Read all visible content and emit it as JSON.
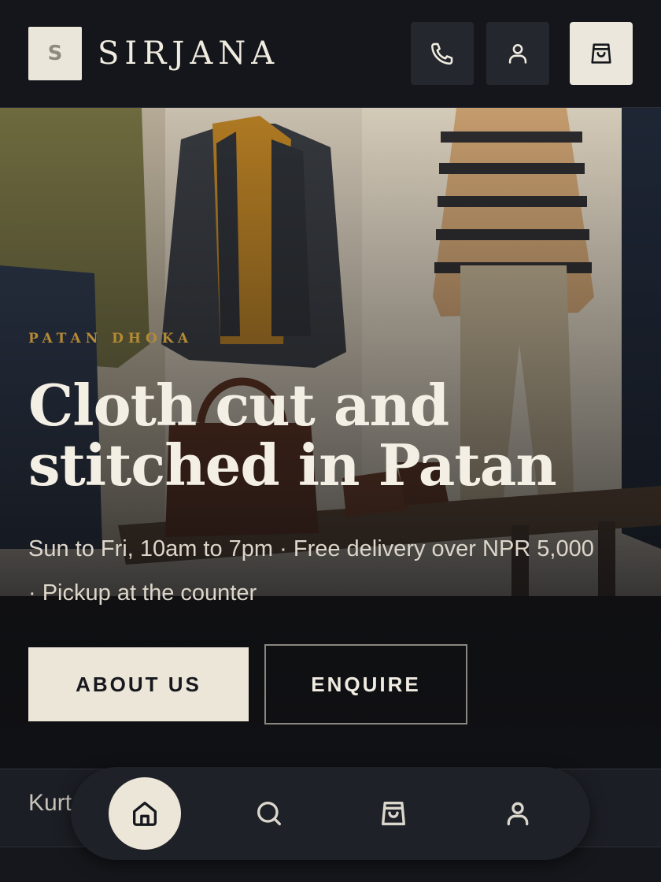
{
  "header": {
    "logo_letter": "S",
    "brand": "SIRJANA",
    "icons": [
      "phone-icon",
      "user-icon",
      "shopping-bag-icon"
    ]
  },
  "hero": {
    "eyebrow": "PATAN DHOKA",
    "headline": "Cloth cut and stitched in Patan",
    "subline": "Sun to Fri, 10am to 7pm · Free delivery over NPR 5,000 · Pickup at the counter",
    "primary_button": "ABOUT US",
    "secondary_button": "ENQUIRE"
  },
  "category_strip": {
    "first_item": "Kurt"
  },
  "bottom_nav": {
    "items": [
      "home-icon",
      "search-icon",
      "shopping-bag-icon",
      "user-icon"
    ],
    "active": "home-icon"
  },
  "colors": {
    "background": "#15171c",
    "cream": "#ece6d9",
    "accent_gold": "#b48a35"
  }
}
